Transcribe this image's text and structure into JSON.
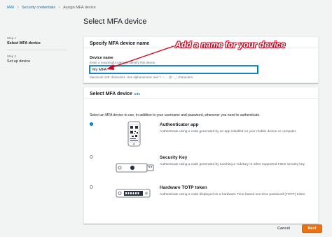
{
  "breadcrumb": {
    "items": [
      "IAM",
      "Security credentials",
      "Assign MFA device"
    ],
    "separator": ">"
  },
  "steps": [
    {
      "number": "Step 1",
      "label": "Select MFA device",
      "active": true
    },
    {
      "number": "Step 2",
      "label": "Set up device",
      "active": false
    }
  ],
  "page_title": "Select MFA device",
  "name_panel": {
    "heading": "Specify MFA device name",
    "field_label": "Device name",
    "field_description": "Enter a meaningful name to identify this device.",
    "field_value": "My MFA",
    "constraint": "Maximum 128 characters. Use alphanumeric and '+ = , . @ - _' characters."
  },
  "annotation": {
    "text": "Add a name for your device",
    "color": "#d9001b"
  },
  "device_panel": {
    "heading": "Select MFA device",
    "info_link": "Info",
    "intro": "Select an MFA device to use, in addition to your username and password, whenever you need to authenticate.",
    "options": [
      {
        "title": "Authenticator app",
        "description": "Authenticate using a code generated by an app installed on your mobile device or computer.",
        "selected": true,
        "icon": "phone-qr-icon"
      },
      {
        "title": "Security Key",
        "description": "Authenticate using a code generated by touching a YubiKey or other supported FIDO security key.",
        "selected": false,
        "icon": "usb-key-icon"
      },
      {
        "title": "Hardware TOTP token",
        "description": "Authenticate using a code displayed on a hardware Time-based one-time password (TOTP) token.",
        "selected": false,
        "icon": "totp-token-icon"
      }
    ]
  },
  "footer": {
    "cancel_label": "Cancel",
    "next_label": "Next"
  },
  "colors": {
    "accent": "#0073bb",
    "primary_button": "#ec7211",
    "background": "#f2f3f3"
  }
}
